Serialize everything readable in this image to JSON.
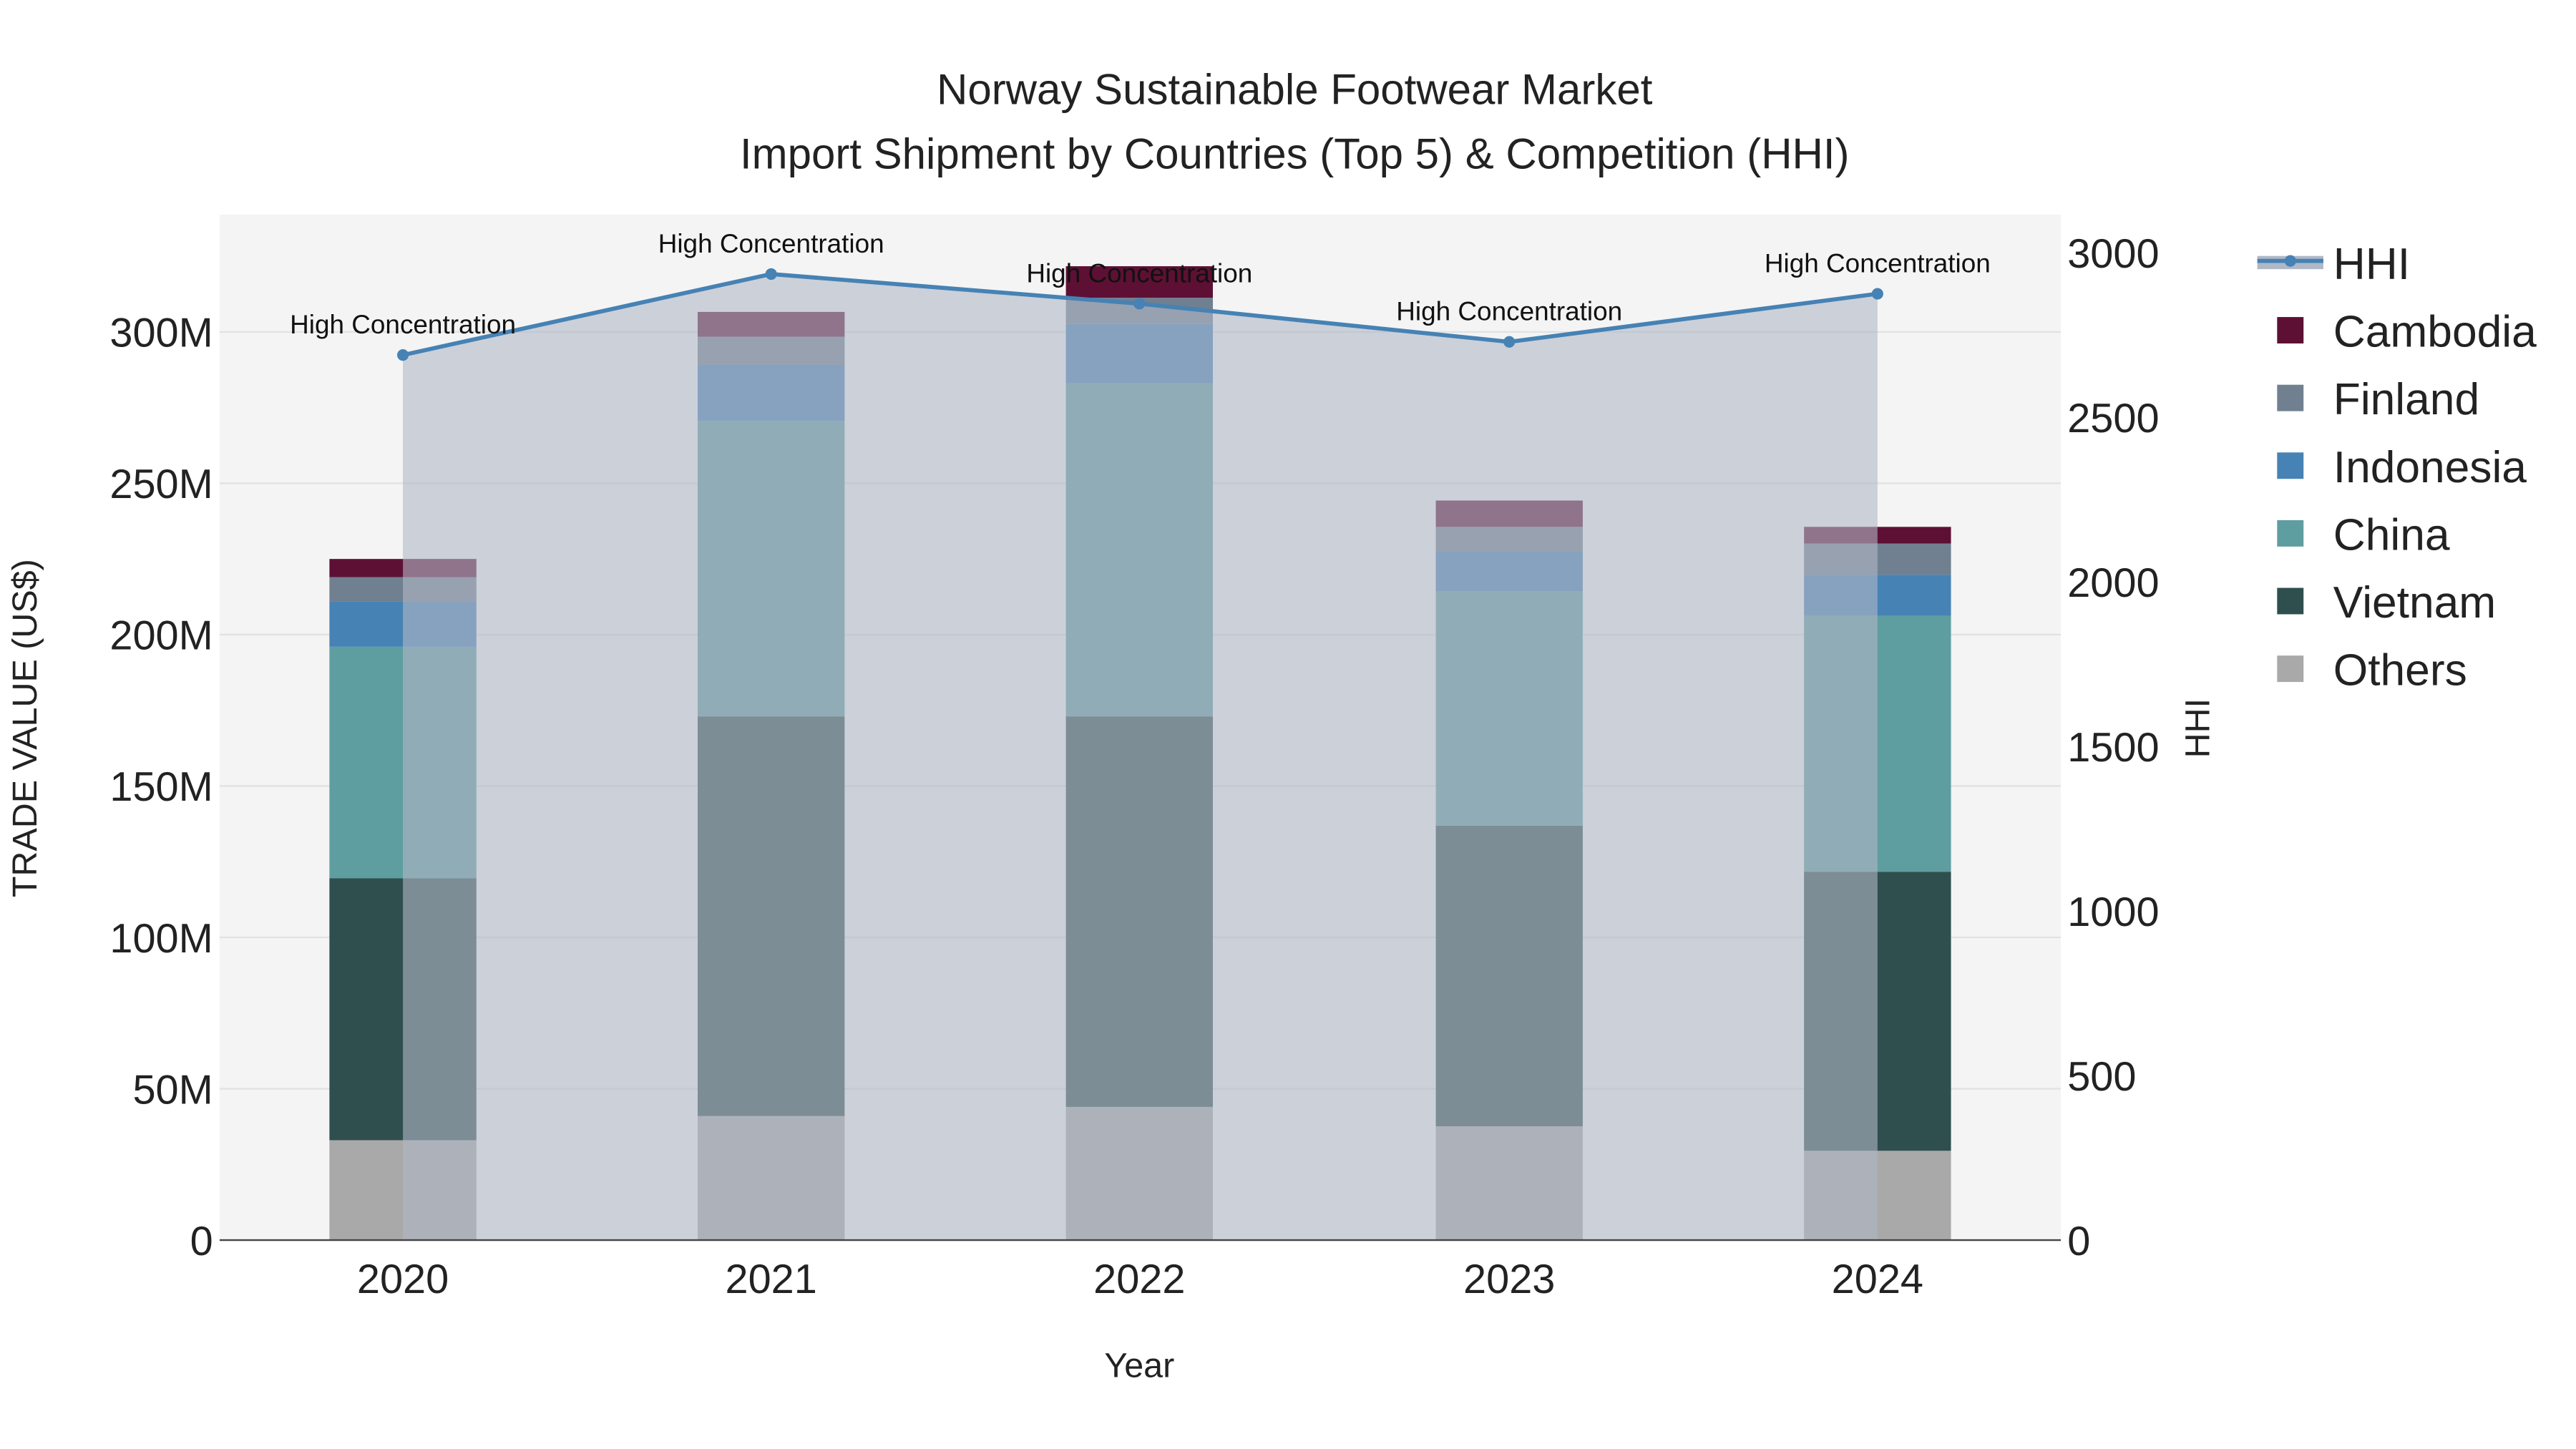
{
  "chart_data": {
    "type": "bar",
    "title": "Norway Sustainable Footwear Market",
    "subtitle": "Import Shipment by Countries (Top 5) & Competition (HHI)",
    "xlabel": "Year",
    "ylabel": "TRADE VALUE (US$)",
    "y2label": "HHI",
    "categories": [
      "2020",
      "2021",
      "2022",
      "2023",
      "2024"
    ],
    "ylim": [
      0,
      330
    ],
    "y_unit": "M",
    "yticks": [
      0,
      50,
      100,
      150,
      200,
      250,
      300
    ],
    "ytick_labels": [
      "0",
      "50M",
      "100M",
      "150M",
      "200M",
      "250M",
      "300M"
    ],
    "y2lim": [
      0,
      3100
    ],
    "y2ticks": [
      0,
      500,
      1000,
      1500,
      2000,
      2500,
      3000
    ],
    "y2tick_labels": [
      "0",
      "500",
      "1000",
      "1500",
      "2000",
      "2500",
      "3000"
    ],
    "series": [
      {
        "name": "Others",
        "color": "#a9a9a9",
        "values": [
          33,
          41,
          44,
          37.6,
          29.5
        ]
      },
      {
        "name": "Vietnam",
        "color": "#2f4f4f",
        "values": [
          86.5,
          132,
          129,
          99.3,
          92.2
        ]
      },
      {
        "name": "China",
        "color": "#5f9ea0",
        "values": [
          76.5,
          97.6,
          110,
          77.5,
          84.5
        ]
      },
      {
        "name": "Indonesia",
        "color": "#4682b4",
        "values": [
          15,
          18.5,
          19.6,
          13,
          13.6
        ]
      },
      {
        "name": "Finland",
        "color": "#708090",
        "values": [
          8,
          9.3,
          8.7,
          8.2,
          10.3
        ]
      },
      {
        "name": "Cambodia",
        "color": "#5e1034",
        "values": [
          6,
          8.2,
          10.4,
          8.7,
          5.5
        ]
      }
    ],
    "line": {
      "name": "HHI",
      "color": "#4682b4",
      "values": [
        2689,
        2935,
        2845,
        2729,
        2875
      ],
      "annotations": [
        "High Concentration",
        "High Concentration",
        "High Concentration",
        "High Concentration",
        "High Concentration"
      ]
    },
    "legend": [
      "HHI",
      "Cambodia",
      "Finland",
      "Indonesia",
      "China",
      "Vietnam",
      "Others"
    ],
    "legend_position": "right",
    "grid": true
  }
}
